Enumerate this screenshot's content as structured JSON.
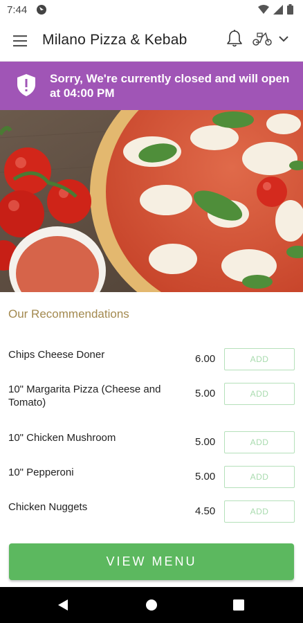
{
  "status_bar": {
    "time": "7:44"
  },
  "app_bar": {
    "title": "Milano Pizza & Kebab"
  },
  "banner": {
    "message": "Sorry, We're currently closed and will open at 04:00 PM",
    "color": "#a055b6"
  },
  "recommendations": {
    "title": "Our Recommendations",
    "items": [
      {
        "name": "Chips Cheese Doner",
        "price": "6.00",
        "action": "ADD"
      },
      {
        "name": "10\" Margarita Pizza (Cheese and Tomato)",
        "price": "5.00",
        "action": "ADD"
      },
      {
        "name": "10\" Chicken Mushroom",
        "price": "5.00",
        "action": "ADD"
      },
      {
        "name": "10\" Pepperoni",
        "price": "5.00",
        "action": "ADD"
      },
      {
        "name": "Chicken Nuggets",
        "price": "4.50",
        "action": "ADD"
      }
    ]
  },
  "footer": {
    "view_menu_label": "VIEW MENU",
    "button_color": "#5cb85f"
  },
  "icons": [
    "app-notification-icon",
    "wifi-icon",
    "signal-icon",
    "battery-icon",
    "hamburger-menu-icon",
    "bell-icon",
    "scooter-delivery-icon",
    "chevron-down-icon",
    "shield-alert-icon",
    "back-icon",
    "home-icon",
    "recents-icon"
  ]
}
